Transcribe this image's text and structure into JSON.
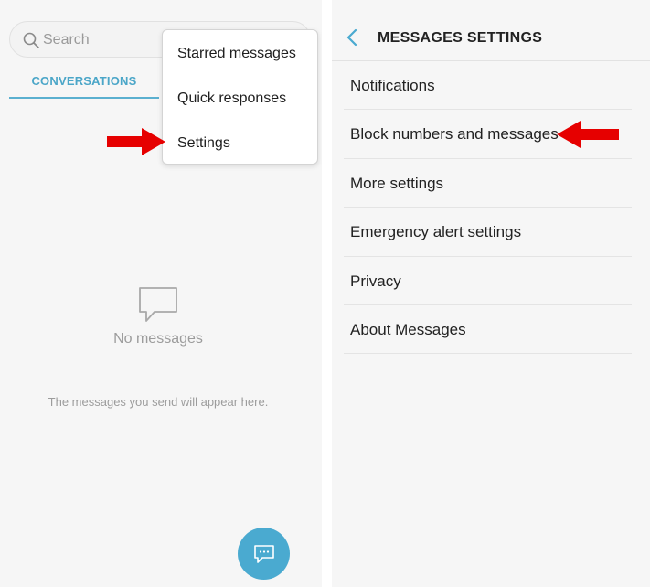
{
  "left_screen": {
    "search": {
      "placeholder": "Search"
    },
    "tabs": [
      {
        "label": "CONVERSATIONS",
        "active": true
      }
    ],
    "overflow_menu": {
      "items": [
        {
          "label": "Starred messages"
        },
        {
          "label": "Quick responses"
        },
        {
          "label": "Settings",
          "highlighted_by_arrow": true
        }
      ]
    },
    "empty_state": {
      "title": "No messages",
      "subtitle": "The messages you send will appear here."
    },
    "fab": {
      "icon": "compose-message-icon"
    }
  },
  "right_screen": {
    "header": {
      "title": "MESSAGES SETTINGS",
      "back_icon": "chevron-left-icon"
    },
    "settings_items": [
      {
        "label": "Notifications"
      },
      {
        "label": "Block numbers and messages",
        "highlighted_by_arrow": true
      },
      {
        "label": "More settings"
      },
      {
        "label": "Emergency alert settings"
      },
      {
        "label": "Privacy"
      },
      {
        "label": "About Messages"
      }
    ]
  },
  "colors": {
    "accent": "#4aaad0",
    "tab_text": "#4ba6c8",
    "annotation_arrow": "#e60000",
    "background": "#f6f6f6"
  }
}
